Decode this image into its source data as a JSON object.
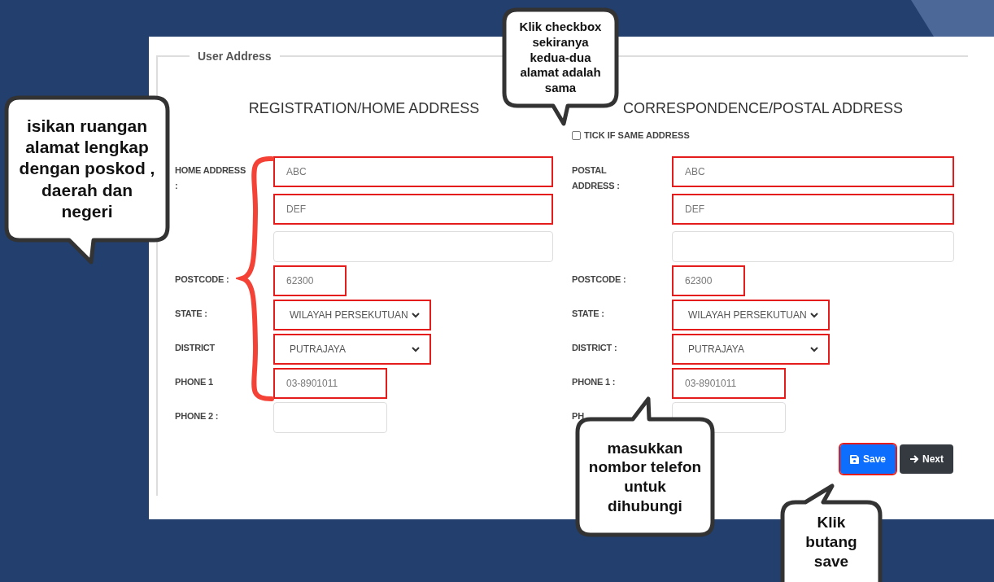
{
  "section_title": "User Address",
  "columns": [
    {
      "heading": "REGISTRATION/HOME ADDRESS",
      "rows": [
        {
          "kind": "address",
          "label": "HOME ADDRESS :",
          "inputs": [
            {
              "value": "ABC",
              "highlighted": true
            },
            {
              "value": "DEF",
              "highlighted": true
            },
            {
              "highlighted": false
            }
          ]
        },
        {
          "kind": "postcode",
          "label": "POSTCODE :",
          "inputs": [
            {
              "value": "62300",
              "highlighted": true
            }
          ]
        },
        {
          "kind": "select",
          "label": "STATE :",
          "inputs": [
            {
              "value": "WILAYAH PERSEKUTUAN",
              "highlighted": true
            }
          ]
        },
        {
          "kind": "select",
          "label": "DISTRICT",
          "inputs": [
            {
              "value": "PUTRAJAYA",
              "highlighted": true
            }
          ]
        },
        {
          "kind": "phone",
          "label": "PHONE 1",
          "inputs": [
            {
              "value": "03-8901011",
              "highlighted": true
            }
          ]
        },
        {
          "kind": "phone",
          "label": "PHONE 2 :",
          "inputs": [
            {
              "highlighted": false
            }
          ]
        }
      ]
    },
    {
      "heading": "CORRESPONDENCE/POSTAL ADDRESS",
      "checkbox": {
        "label": "TICK IF SAME ADDRESS",
        "checked": false
      },
      "rows": [
        {
          "kind": "address",
          "label": "POSTAL ADDRESS :",
          "inputs": [
            {
              "value": "ABC",
              "highlighted": true
            },
            {
              "value": "DEF",
              "highlighted": true
            },
            {
              "highlighted": false
            }
          ]
        },
        {
          "kind": "postcode",
          "label": "POSTCODE :",
          "inputs": [
            {
              "value": "62300",
              "highlighted": true
            }
          ]
        },
        {
          "kind": "select",
          "label": "STATE :",
          "inputs": [
            {
              "value": "WILAYAH PERSEKUTUAN",
              "highlighted": true
            }
          ]
        },
        {
          "kind": "select",
          "label": "DISTRICT :",
          "inputs": [
            {
              "value": "PUTRAJAYA",
              "highlighted": true
            }
          ]
        },
        {
          "kind": "phone",
          "label": "PHONE 1 :",
          "inputs": [
            {
              "value": "03-8901011",
              "highlighted": true
            }
          ]
        },
        {
          "kind": "phone",
          "label": "PH",
          "inputs": [
            {
              "highlighted": false
            }
          ]
        }
      ]
    }
  ],
  "buttons": [
    {
      "kind": "save",
      "label": "Save",
      "highlighted": true
    },
    {
      "kind": "next",
      "label": "Next",
      "highlighted": false
    }
  ],
  "callouts": [
    {
      "text": "isikan ruangan alamat lengkap dengan poskod , daerah dan negeri"
    },
    {
      "text": "Klik checkbox sekiranya kedua-dua alamat adalah sama"
    },
    {
      "text": "masukkan nombor telefon untuk dihubungi"
    },
    {
      "text": "Klik butang save"
    }
  ]
}
